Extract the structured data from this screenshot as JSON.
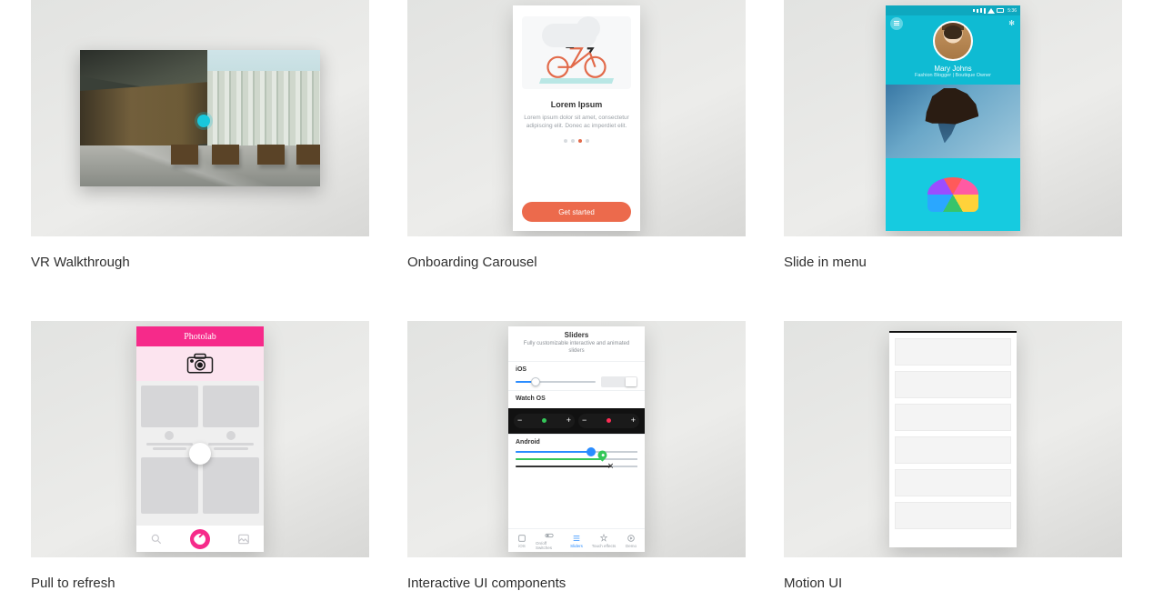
{
  "cards": [
    {
      "id": "vr",
      "title": "VR Walkthrough"
    },
    {
      "id": "onboarding",
      "title": "Onboarding Carousel",
      "mock": {
        "heading": "Lorem Ipsum",
        "body": "Lorem ipsum dolor sit amet, consectetur adipiscing elit. Donec ac imperdiet elit.",
        "cta": "Get started",
        "active_dot_index": 2,
        "dot_count": 4
      }
    },
    {
      "id": "slidein",
      "title": "Slide in menu",
      "mock": {
        "clock": "5:36",
        "name": "Mary Johns",
        "subtitle": "Fashion Blogger | Boutique Owner"
      }
    },
    {
      "id": "ptr",
      "title": "Pull to refresh",
      "mock": {
        "brand": "Photolab"
      }
    },
    {
      "id": "iui",
      "title": "Interactive UI components",
      "mock": {
        "title": "Sliders",
        "subtitle": "Fully customizable interactive and animated sliders",
        "sections": {
          "ios": "iOS",
          "watch": "Watch OS",
          "android": "Android"
        },
        "tabs": [
          "iOS",
          "On/off Switches",
          "Sliders",
          "Touch effects",
          "Demo"
        ],
        "active_tab_index": 2
      }
    },
    {
      "id": "motion",
      "title": "Motion UI"
    }
  ]
}
